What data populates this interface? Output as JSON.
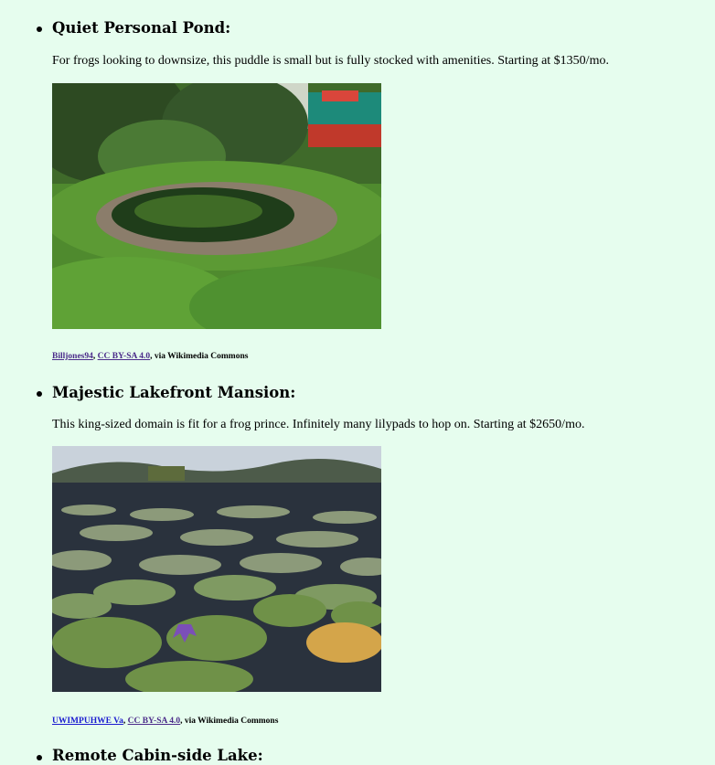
{
  "listings": [
    {
      "title": "Quiet Personal Pond:",
      "description": "For frogs looking to downsize, this puddle is small but is fully stocked with amenities. Starting at $1350/mo.",
      "credit": {
        "author": "Billjones94",
        "license": "CC BY-SA 4.0",
        "source": ", via Wikimedia Commons"
      }
    },
    {
      "title": "Majestic Lakefront Mansion:",
      "description": "This king-sized domain is fit for a frog prince. Infinitely many lilypads to hop on. Starting at $2650/mo.",
      "credit": {
        "author": "UWIMPUHWE Va",
        "license": "CC BY-SA 4.0",
        "source": ", via Wikimedia Commons"
      }
    },
    {
      "title": "Remote Cabin-side Lake:"
    }
  ],
  "colors": {
    "background": "#e6fdee",
    "visited_link": "#4b2b8a",
    "link": "#1b1bd0"
  }
}
